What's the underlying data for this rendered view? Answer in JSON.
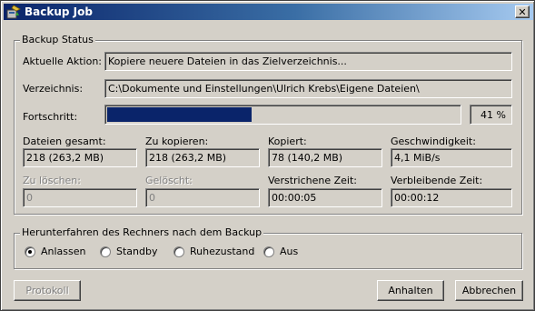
{
  "window": {
    "title": "Backup Job",
    "close_glyph": "✕"
  },
  "status": {
    "group_title": "Backup Status",
    "action_label": "Aktuelle Aktion:",
    "action_value": "Kopiere neuere Dateien in das Zielverzeichnis...",
    "dir_label": "Verzeichnis:",
    "dir_value": "C:\\Dokumente und Einstellungen\\Ulrich Krebs\\Eigene Dateien\\",
    "progress_label": "Fortschritt:",
    "progress_fraction": 0.41,
    "progress_text": "41 %",
    "stats": [
      {
        "label": "Dateien gesamt:",
        "value": "218 (263,2 MB)",
        "enabled": true
      },
      {
        "label": "Zu kopieren:",
        "value": "218 (263,2 MB)",
        "enabled": true
      },
      {
        "label": "Kopiert:",
        "value": "78 (140,2 MB)",
        "enabled": true
      },
      {
        "label": "Geschwindigkeit:",
        "value": "4,1 MiB/s",
        "enabled": true
      },
      {
        "label": "Zu löschen:",
        "value": "0",
        "enabled": false
      },
      {
        "label": "Gelöscht:",
        "value": "0",
        "enabled": false
      },
      {
        "label": "Verstrichene Zeit:",
        "value": "00:00:05",
        "enabled": true
      },
      {
        "label": "Verbleibende Zeit:",
        "value": "00:00:12",
        "enabled": true
      }
    ]
  },
  "shutdown": {
    "group_title": "Herunterfahren des Rechners nach dem Backup",
    "options": [
      {
        "label": "Anlassen",
        "checked": true
      },
      {
        "label": "Standby",
        "checked": false
      },
      {
        "label": "Ruhezustand",
        "checked": false
      },
      {
        "label": "Aus",
        "checked": false
      }
    ]
  },
  "buttons": {
    "log": "Protokoll",
    "pause": "Anhalten",
    "cancel": "Abbrechen"
  },
  "colors": {
    "title_start": "#0a246a",
    "title_end": "#a6caf0",
    "progress": "#0a246a",
    "face": "#d4d0c8"
  }
}
